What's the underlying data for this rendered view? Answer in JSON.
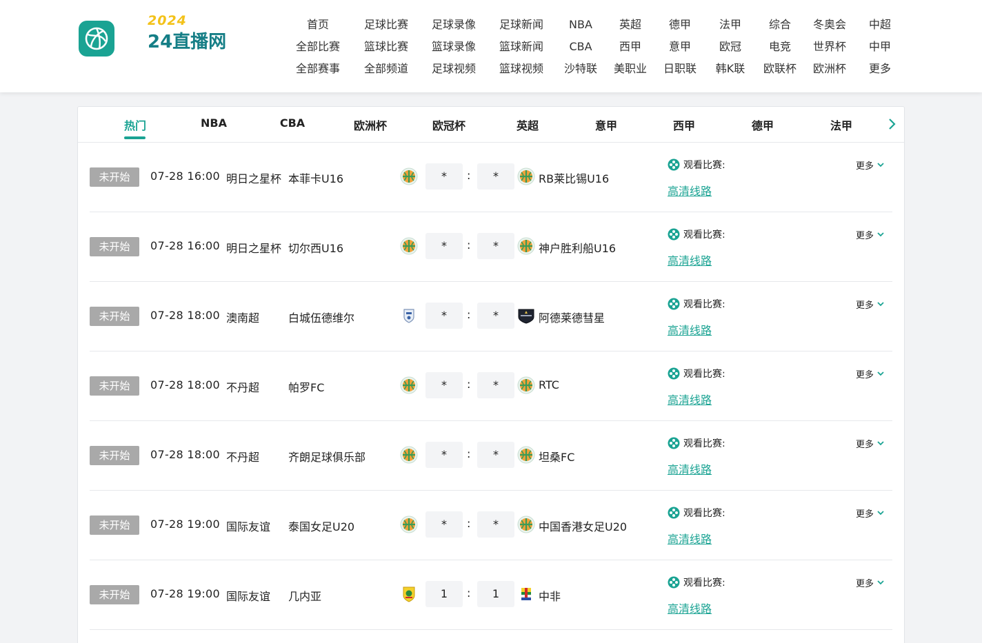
{
  "brand": {
    "year": "2024",
    "name": "24直播网",
    "accent": "#1aa393",
    "year_color": "#f3c21a",
    "name_color": "#157e86"
  },
  "nav": {
    "columns": [
      [
        "首页",
        "全部比赛",
        "全部赛事"
      ],
      [
        "足球比赛",
        "篮球比赛",
        "全部频道"
      ],
      [
        "足球录像",
        "篮球录像",
        "足球视频"
      ],
      [
        "足球新闻",
        "篮球新闻",
        "篮球视频"
      ],
      [
        "NBA",
        "CBA",
        "沙特联"
      ],
      [
        "英超",
        "西甲",
        "美职业"
      ],
      [
        "德甲",
        "意甲",
        "日职联"
      ],
      [
        "法甲",
        "欧冠",
        "韩K联"
      ],
      [
        "综合",
        "电竞",
        "欧联杯"
      ],
      [
        "冬奥会",
        "世界杯",
        "欧洲杯"
      ],
      [
        "中超",
        "中甲",
        "更多"
      ]
    ]
  },
  "tabs": [
    "热门",
    "NBA",
    "CBA",
    "欧洲杯",
    "欧冠杯",
    "英超",
    "意甲",
    "西甲",
    "德甲",
    "法甲"
  ],
  "active_tab": "热门",
  "watch_label": "观看比赛:",
  "hd_label": "高清线路",
  "more_label": "更多",
  "matches": [
    {
      "status": "未开始",
      "time": "07-28 16:00",
      "league": "明日之星杯",
      "home": "本菲卡U16",
      "home_logo": "football-crest-icon",
      "home_score": "*",
      "away_score": "*",
      "away": "RB莱比锡U16",
      "away_logo": "football-crest-icon"
    },
    {
      "status": "未开始",
      "time": "07-28 16:00",
      "league": "明日之星杯",
      "home": "切尔西U16",
      "home_logo": "football-crest-icon",
      "home_score": "*",
      "away_score": "*",
      "away": "神户胜利船U16",
      "away_logo": "football-crest-icon"
    },
    {
      "status": "未开始",
      "time": "07-28 18:00",
      "league": "澳南超",
      "home": "白城伍德维尔",
      "home_logo": "shield-crest-icon",
      "home_score": "*",
      "away_score": "*",
      "away": "阿德莱德彗星",
      "away_logo": "dark-shield-crest-icon"
    },
    {
      "status": "未开始",
      "time": "07-28 18:00",
      "league": "不丹超",
      "home": "帕罗FC",
      "home_logo": "football-crest-icon",
      "home_score": "*",
      "away_score": "*",
      "away": "RTC",
      "away_logo": "football-crest-icon"
    },
    {
      "status": "未开始",
      "time": "07-28 18:00",
      "league": "不丹超",
      "home": "齐朗足球俱乐部",
      "home_logo": "football-crest-icon",
      "home_score": "*",
      "away_score": "*",
      "away": "坦桑FC",
      "away_logo": "football-crest-icon"
    },
    {
      "status": "未开始",
      "time": "07-28 19:00",
      "league": "国际友谊",
      "home": "泰国女足U20",
      "home_logo": "football-crest-icon",
      "home_score": "*",
      "away_score": "*",
      "away": "中国香港女足U20",
      "away_logo": "football-crest-icon"
    },
    {
      "status": "未开始",
      "time": "07-28 19:00",
      "league": "国际友谊",
      "home": "几内亚",
      "home_logo": "guinea-crest-icon",
      "home_score": "1",
      "away_score": "1",
      "away": "中非",
      "away_logo": "central-africa-crest-icon"
    }
  ]
}
